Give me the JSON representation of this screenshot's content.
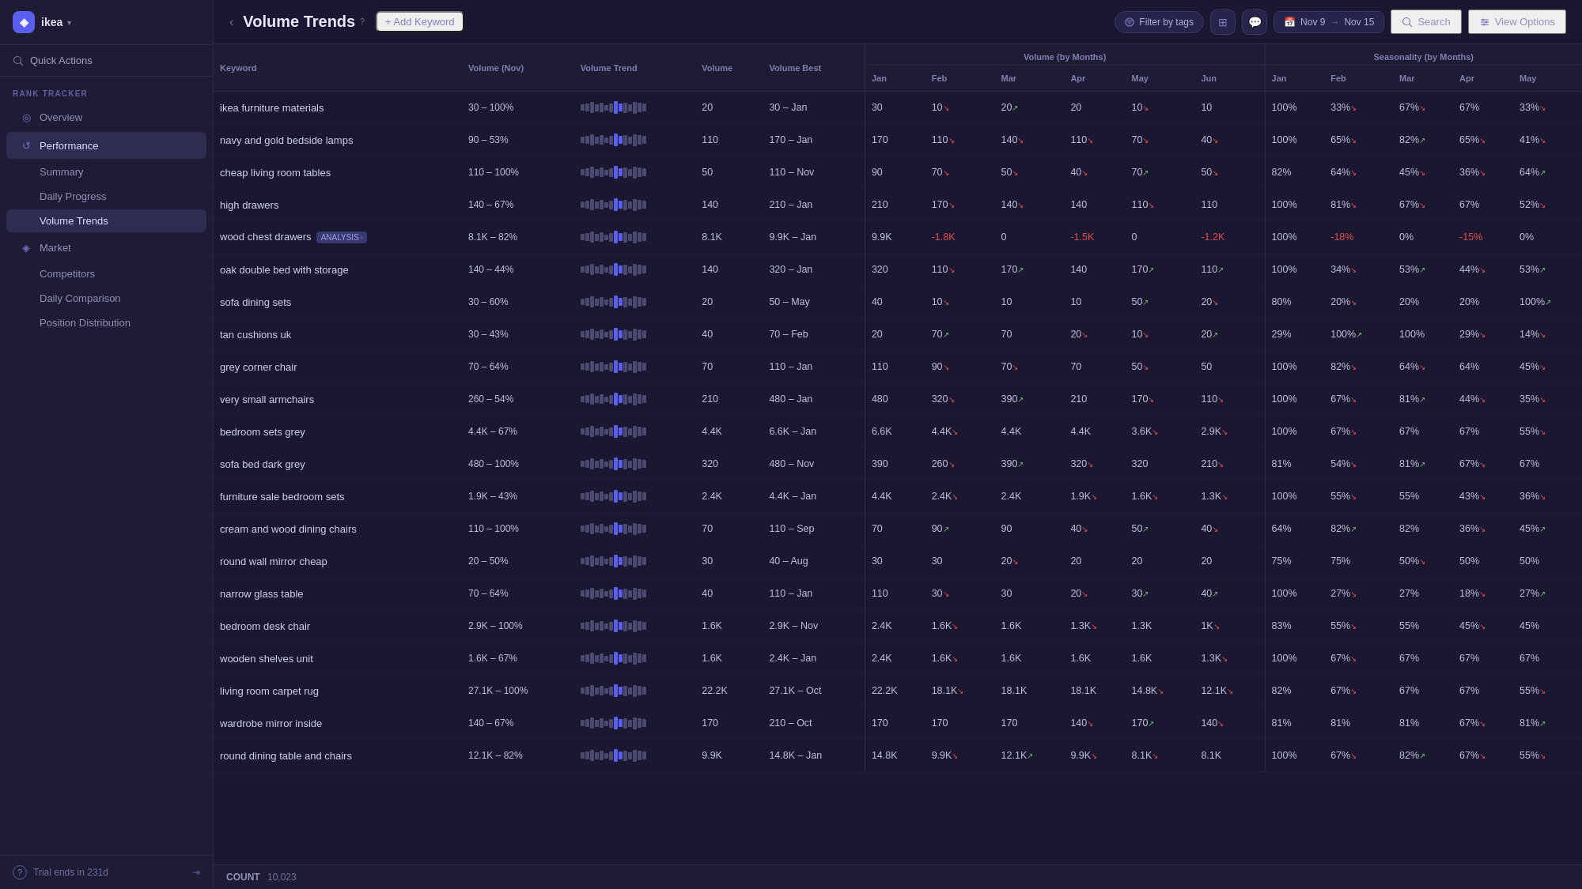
{
  "app": {
    "brand": "ikea",
    "brand_icon": "◈"
  },
  "sidebar": {
    "quick_actions_label": "Quick Actions",
    "section_label": "RANK TRACKER",
    "items": [
      {
        "id": "overview",
        "label": "Overview",
        "icon": "◎"
      },
      {
        "id": "performance",
        "label": "Performance",
        "icon": "↺",
        "active": true,
        "children": [
          {
            "id": "summary",
            "label": "Summary"
          },
          {
            "id": "daily-progress",
            "label": "Daily Progress"
          },
          {
            "id": "volume-trends",
            "label": "Volume Trends",
            "active": true
          }
        ]
      },
      {
        "id": "market",
        "label": "Market",
        "icon": "◈",
        "children": [
          {
            "id": "competitors",
            "label": "Competitors"
          },
          {
            "id": "daily-comparison",
            "label": "Daily Comparison"
          },
          {
            "id": "position-distribution",
            "label": "Position Distribution"
          }
        ]
      }
    ],
    "trial_text": "Trial ends in 231d"
  },
  "header": {
    "page_title": "Volume Trends",
    "page_title_sup": "?",
    "add_keyword_label": "+ Add Keyword",
    "filter_label": "Filter by tags",
    "search_label": "Search",
    "view_options_label": "View Options",
    "date_from": "Nov 9",
    "date_to": "Nov 15"
  },
  "table": {
    "col_headers": {
      "keyword": "Keyword",
      "volume_nov": "Volume (Nov)",
      "volume_trend": "Volume Trend",
      "volume": "Volume",
      "volume_best": "Volume Best",
      "volume_by_months": "Volume (by Months)",
      "seasonality_by_months": "Seasonality (by Months)",
      "months": [
        "Jan",
        "Feb",
        "Mar",
        "Apr",
        "May",
        "Jun"
      ],
      "season_months": [
        "Jan",
        "Feb",
        "Mar",
        "Apr",
        "May"
      ]
    },
    "rows": [
      {
        "keyword": "ikea furniture materials",
        "volume_nov": "30 – 100%",
        "volume": 20,
        "volume_best": "30 – Jan",
        "jan": "30",
        "feb": "10",
        "feb_dir": "down",
        "mar": "20",
        "mar_dir": "up",
        "apr": "20",
        "may": "10",
        "may_dir": "down",
        "jun": "10",
        "s_jan": "100%",
        "s_feb": "33%",
        "s_feb_dir": "down",
        "s_mar": "67%",
        "s_mar_dir": "down",
        "s_apr": "67%",
        "s_may": "33%",
        "s_may_dir": "down"
      },
      {
        "keyword": "navy and gold bedside lamps",
        "volume_nov": "90 – 53%",
        "volume": 110,
        "volume_best": "170 – Jan",
        "jan": "170",
        "feb": "110",
        "feb_dir": "down",
        "mar": "140",
        "mar_dir": "down",
        "apr": "110",
        "apr_dir": "down",
        "may": "70",
        "may_dir": "down",
        "jun": "40",
        "jun_dir": "down",
        "s_jan": "100%",
        "s_feb": "65%",
        "s_feb_dir": "down",
        "s_mar": "82%",
        "s_mar_dir": "up",
        "s_apr": "65%",
        "s_apr_dir": "down",
        "s_may": "41%",
        "s_may_dir": "down"
      },
      {
        "keyword": "cheap living room tables",
        "volume_nov": "110 – 100%",
        "volume": 50,
        "volume_best": "110 – Nov",
        "jan": "90",
        "feb": "70",
        "feb_dir": "down",
        "mar": "50",
        "mar_dir": "down",
        "apr": "40",
        "apr_dir": "down",
        "may": "70",
        "may_dir": "up",
        "jun": "50",
        "jun_dir": "down",
        "s_jan": "82%",
        "s_feb": "64%",
        "s_feb_dir": "down",
        "s_mar": "45%",
        "s_mar_dir": "down",
        "s_apr": "36%",
        "s_apr_dir": "down",
        "s_may": "64%",
        "s_may_dir": "up"
      },
      {
        "keyword": "high drawers",
        "volume_nov": "140 – 67%",
        "volume": 140,
        "volume_best": "210 – Jan",
        "jan": "210",
        "feb": "170",
        "feb_dir": "down",
        "mar": "140",
        "mar_dir": "down",
        "apr": "140",
        "may": "110",
        "may_dir": "down",
        "jun": "110",
        "s_jan": "100%",
        "s_feb": "81%",
        "s_feb_dir": "down",
        "s_mar": "67%",
        "s_mar_dir": "down",
        "s_apr": "67%",
        "s_may": "52%",
        "s_may_dir": "down"
      },
      {
        "keyword": "wood chest drawers",
        "volume_nov": "8.1K – 82%",
        "volume": "8.1K",
        "volume_best": "9.9K – Jan",
        "analysis": true,
        "jan": "9.9K",
        "feb": "-1.8K",
        "feb_dir": "red",
        "mar": "0",
        "apr": "-1.5K",
        "apr_dir": "red",
        "may": "0",
        "jun": "-1.2K",
        "jun_dir": "red",
        "s_jan": "100%",
        "s_feb": "-18%",
        "s_feb_dir": "red",
        "s_mar": "0%",
        "s_apr": "-15%",
        "s_apr_dir": "red",
        "s_may": "0%"
      },
      {
        "keyword": "oak double bed with storage",
        "volume_nov": "140 – 44%",
        "volume": 140,
        "volume_best": "320 – Jan",
        "jan": "320",
        "feb": "110",
        "feb_dir": "down",
        "mar": "170",
        "mar_dir": "up",
        "apr": "140",
        "may_dir": "up",
        "may": "170",
        "jun": "110",
        "jun_dir": "up",
        "s_jan": "100%",
        "s_feb": "34%",
        "s_feb_dir": "down",
        "s_mar": "53%",
        "s_mar_dir": "up",
        "s_apr": "44%",
        "s_apr_dir": "down",
        "s_may": "53%",
        "s_may_dir": "up"
      },
      {
        "keyword": "sofa dining sets",
        "volume_nov": "30 – 60%",
        "volume": 20,
        "volume_best": "50 – May",
        "jan": "40",
        "feb": "10",
        "feb_dir": "down",
        "mar": "10",
        "apr": "10",
        "may": "50",
        "may_dir": "up",
        "jun": "20",
        "jun_dir": "down",
        "s_jan": "80%",
        "s_feb": "20%",
        "s_feb_dir": "down",
        "s_mar": "20%",
        "s_apr": "20%",
        "s_may": "100%",
        "s_may_dir": "up"
      },
      {
        "keyword": "tan cushions uk",
        "volume_nov": "30 – 43%",
        "volume": 40,
        "volume_best": "70 – Feb",
        "jan": "20",
        "feb": "70",
        "feb_dir": "up",
        "mar": "70",
        "apr": "20",
        "apr_dir": "down",
        "may": "10",
        "may_dir": "down",
        "jun": "20",
        "jun_dir": "up",
        "s_jan": "29%",
        "s_feb": "100%",
        "s_feb_dir": "up",
        "s_mar": "100%",
        "s_apr": "29%",
        "s_apr_dir": "down",
        "s_may": "14%",
        "s_may_dir": "down"
      },
      {
        "keyword": "grey corner chair",
        "volume_nov": "70 – 64%",
        "volume": 70,
        "volume_best": "110 – Jan",
        "jan": "110",
        "feb": "90",
        "feb_dir": "down",
        "mar": "70",
        "mar_dir": "down",
        "apr": "70",
        "may": "50",
        "may_dir": "down",
        "jun": "50",
        "s_jan": "100%",
        "s_feb": "82%",
        "s_feb_dir": "down",
        "s_mar": "64%",
        "s_mar_dir": "down",
        "s_apr": "64%",
        "s_may": "45%",
        "s_may_dir": "down"
      },
      {
        "keyword": "very small armchairs",
        "volume_nov": "260 – 54%",
        "volume": 210,
        "volume_best": "480 – Jan",
        "jan": "480",
        "feb": "320",
        "feb_dir": "down",
        "mar": "390",
        "mar_dir": "up",
        "apr": "210",
        "may_dir": "down",
        "may": "170",
        "may_d": "down",
        "jun": "110",
        "jun_dir": "down",
        "s_jan": "100%",
        "s_feb": "67%",
        "s_feb_dir": "down",
        "s_mar": "81%",
        "s_mar_dir": "up",
        "s_apr": "44%",
        "s_apr_dir": "down",
        "s_may": "35%",
        "s_may_dir": "down"
      },
      {
        "keyword": "bedroom sets grey",
        "volume_nov": "4.4K – 67%",
        "volume": "4.4K",
        "volume_best": "6.6K – Jan",
        "jan": "6.6K",
        "feb": "4.4K",
        "feb_dir": "down",
        "mar": "4.4K",
        "apr": "4.4K",
        "may": "3.6K",
        "may_dir": "down",
        "jun": "2.9K",
        "jun_dir": "down",
        "s_jan": "100%",
        "s_feb": "67%",
        "s_feb_dir": "down",
        "s_mar": "67%",
        "s_apr": "67%",
        "s_may": "55%",
        "s_may_dir": "down"
      },
      {
        "keyword": "sofa bed dark grey",
        "volume_nov": "480 – 100%",
        "volume": 320,
        "volume_best": "480 – Nov",
        "jan": "390",
        "feb": "260",
        "feb_dir": "down",
        "mar": "390",
        "mar_dir": "up",
        "apr": "320",
        "apr_dir": "down",
        "may": "320",
        "jun": "210",
        "jun_dir": "down",
        "s_jan": "81%",
        "s_feb": "54%",
        "s_feb_dir": "down",
        "s_mar": "81%",
        "s_mar_dir": "up",
        "s_apr": "67%",
        "s_apr_dir": "down",
        "s_may": "67%"
      },
      {
        "keyword": "furniture sale bedroom sets",
        "volume_nov": "1.9K – 43%",
        "volume": "2.4K",
        "volume_best": "4.4K – Jan",
        "jan": "4.4K",
        "feb": "2.4K",
        "feb_dir": "down",
        "mar": "2.4K",
        "apr": "1.9K",
        "apr_dir": "down",
        "may": "1.6K",
        "may_dir": "down",
        "jun": "1.3K",
        "jun_dir": "down",
        "s_jan": "100%",
        "s_feb": "55%",
        "s_feb_dir": "down",
        "s_mar": "55%",
        "s_apr": "43%",
        "s_apr_dir": "down",
        "s_may": "36%",
        "s_may_dir": "down"
      },
      {
        "keyword": "cream and wood dining chairs",
        "volume_nov": "110 – 100%",
        "volume": 70,
        "volume_best": "110 – Sep",
        "jan": "70",
        "feb": "90",
        "feb_dir": "up",
        "mar": "90",
        "apr": "40",
        "apr_dir": "down",
        "may": "50",
        "may_dir": "up",
        "jun": "40",
        "jun_dir": "down",
        "s_jan": "64%",
        "s_feb": "82%",
        "s_feb_dir": "up",
        "s_mar": "82%",
        "s_apr": "36%",
        "s_apr_dir": "down",
        "s_may": "45%",
        "s_may_dir": "up"
      },
      {
        "keyword": "round wall mirror cheap",
        "volume_nov": "20 – 50%",
        "volume": 30,
        "volume_best": "40 – Aug",
        "jan": "30",
        "feb": "30",
        "mar": "20",
        "mar_dir": "down",
        "apr": "20",
        "may": "20",
        "jun": "20",
        "s_jan": "75%",
        "s_feb": "75%",
        "s_mar": "50%",
        "s_mar_dir": "down",
        "s_apr": "50%",
        "s_may": "50%"
      },
      {
        "keyword": "narrow glass table",
        "volume_nov": "70 – 64%",
        "volume": 40,
        "volume_best": "110 – Jan",
        "jan": "110",
        "feb": "30",
        "feb_dir": "down",
        "mar": "30",
        "apr": "20",
        "apr_dir": "down",
        "may": "30",
        "may_dir": "up",
        "jun": "40",
        "jun_dir": "up",
        "s_jan": "100%",
        "s_feb": "27%",
        "s_feb_dir": "down",
        "s_mar": "27%",
        "s_apr": "18%",
        "s_apr_dir": "down",
        "s_may": "27%",
        "s_may_dir": "up"
      },
      {
        "keyword": "bedroom desk chair",
        "volume_nov": "2.9K – 100%",
        "volume": "1.6K",
        "volume_best": "2.9K – Nov",
        "jan": "2.4K",
        "feb": "1.6K",
        "feb_dir": "down",
        "mar": "1.6K",
        "apr": "1.3K",
        "apr_dir": "down",
        "may": "1.3K",
        "jun": "1K",
        "jun_dir": "down",
        "s_jan": "83%",
        "s_feb": "55%",
        "s_feb_dir": "down",
        "s_mar": "55%",
        "s_apr": "45%",
        "s_apr_dir": "down",
        "s_may": "45%"
      },
      {
        "keyword": "wooden shelves unit",
        "volume_nov": "1.6K – 67%",
        "volume": "1.6K",
        "volume_best": "2.4K – Jan",
        "jan": "2.4K",
        "feb": "1.6K",
        "feb_dir": "down",
        "mar": "1.6K",
        "apr": "1.6K",
        "may": "1.6K",
        "jun": "1.3K",
        "jun_dir": "down",
        "s_jan": "100%",
        "s_feb": "67%",
        "s_feb_dir": "down",
        "s_mar": "67%",
        "s_apr": "67%",
        "s_may": "67%"
      },
      {
        "keyword": "living room carpet rug",
        "volume_nov": "27.1K – 100%",
        "volume": "22.2K",
        "volume_best": "27.1K – Oct",
        "jan": "22.2K",
        "feb": "18.1K",
        "feb_dir": "down",
        "mar": "18.1K",
        "apr": "18.1K",
        "may": "14.8K",
        "may_dir": "down",
        "jun": "12.1K",
        "jun_dir": "down",
        "s_jan": "82%",
        "s_feb": "67%",
        "s_feb_dir": "down",
        "s_mar": "67%",
        "s_apr": "67%",
        "s_may": "55%",
        "s_may_dir": "down"
      },
      {
        "keyword": "wardrobe mirror inside",
        "volume_nov": "140 – 67%",
        "volume": 170,
        "volume_best": "210 – Oct",
        "jan": "170",
        "feb": "170",
        "mar": "170",
        "apr": "140",
        "apr_dir": "down",
        "may": "170",
        "may_dir": "up",
        "jun": "140",
        "jun_dir": "down",
        "s_jan": "81%",
        "s_feb": "81%",
        "s_mar": "81%",
        "s_apr": "67%",
        "s_apr_dir": "down",
        "s_may": "81%",
        "s_may_dir": "up"
      },
      {
        "keyword": "round dining table and chairs",
        "volume_nov": "12.1K – 82%",
        "volume": "9.9K",
        "volume_best": "14.8K – Jan",
        "jan": "14.8K",
        "feb": "9.9K",
        "feb_dir": "down",
        "mar": "12.1K",
        "mar_dir": "up",
        "apr": "9.9K",
        "apr_dir": "down",
        "may": "8.1K",
        "may_dir": "down",
        "jun": "8.1K",
        "s_jan": "100%",
        "s_feb": "67%",
        "s_feb_dir": "down",
        "s_mar": "82%",
        "s_mar_dir": "up",
        "s_apr": "67%",
        "s_apr_dir": "down",
        "s_may": "55%",
        "s_may_dir": "down"
      }
    ],
    "footer": {
      "count_label": "COUNT",
      "count_value": "10,023"
    }
  }
}
